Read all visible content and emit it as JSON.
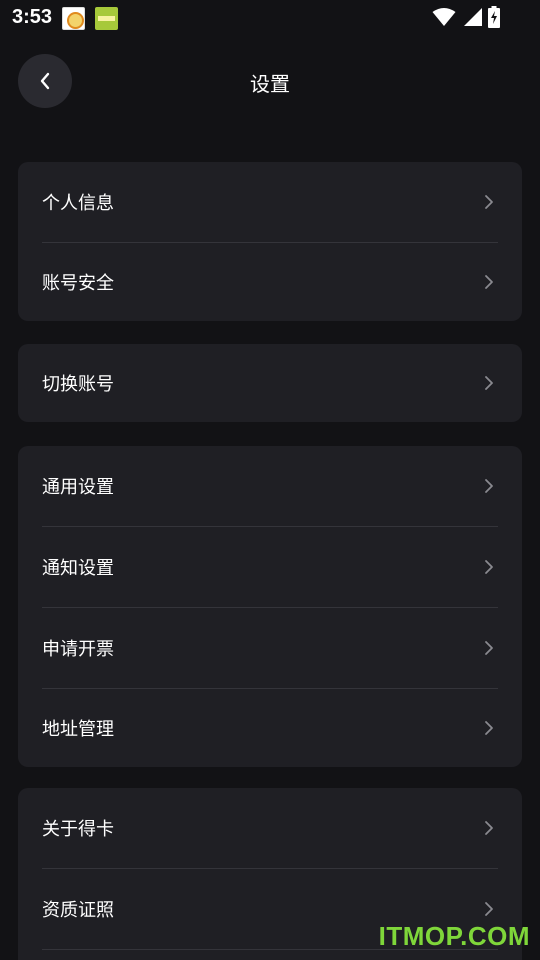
{
  "status_bar": {
    "time": "3:53",
    "icons": [
      "app-icon-yc",
      "app-icon-green",
      "wifi-icon",
      "signal-icon",
      "battery-charging-icon"
    ]
  },
  "header": {
    "title": "设置",
    "back_icon": "chevron-left-icon"
  },
  "groups": [
    {
      "items": [
        {
          "label": "个人信息"
        },
        {
          "label": "账号安全"
        }
      ]
    },
    {
      "items": [
        {
          "label": "切换账号"
        }
      ]
    },
    {
      "items": [
        {
          "label": "通用设置"
        },
        {
          "label": "通知设置"
        },
        {
          "label": "申请开票"
        },
        {
          "label": "地址管理"
        }
      ]
    },
    {
      "items": [
        {
          "label": "关于得卡"
        },
        {
          "label": "资质证照"
        }
      ]
    }
  ],
  "watermark": "ITMOP.COM",
  "colors": {
    "background": "#121215",
    "card": "#1f1f24",
    "divider": "#34343a",
    "text": "#ffffff",
    "chevron": "#8a8a90",
    "watermark": "#7fd63a"
  }
}
